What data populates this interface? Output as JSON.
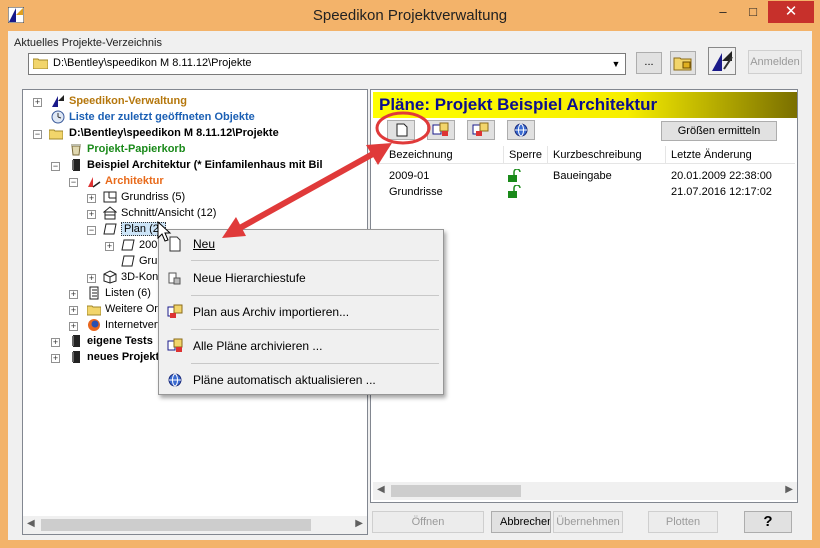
{
  "window": {
    "title": "Speedikon Projektverwaltung",
    "minimize": "–",
    "maximize": "□",
    "close": "✕"
  },
  "directory": {
    "label": "Aktuelles Projekte-Verzeichnis",
    "path": "D:\\Bentley\\speedikon M 8.11.12\\Projekte",
    "browse_label": "...",
    "login_label": "Anmelden"
  },
  "tree": {
    "items": [
      {
        "label": "Speedikon-Verwaltung",
        "color": "#b5770c"
      },
      {
        "label": "Liste der zuletzt geöffneten Objekte",
        "color": "#1a5fb4"
      },
      {
        "label": "D:\\Bentley\\speedikon M 8.11.12\\Projekte",
        "color": "#000000"
      },
      {
        "label": "Projekt-Papierkorb",
        "color": "#1a8a1a"
      },
      {
        "label": "Beispiel Architektur   (* Einfamilenhaus mit Bil",
        "color": "#000000"
      },
      {
        "label": "Architektur",
        "color": "#e86a1a"
      },
      {
        "label": "Grundriss (5)",
        "color": "#000000"
      },
      {
        "label": "Schnitt/Ansicht (12)",
        "color": "#000000"
      },
      {
        "label": "Plan (2)",
        "color": "#000000"
      },
      {
        "label": "200",
        "color": "#000000"
      },
      {
        "label": "Grur",
        "color": "#000000"
      },
      {
        "label": "3D-Kons",
        "color": "#000000"
      },
      {
        "label": "Listen (6)",
        "color": "#000000"
      },
      {
        "label": "Weitere Ord",
        "color": "#000000"
      },
      {
        "label": "Internetverw",
        "color": "#000000"
      },
      {
        "label": "eigene Tests",
        "color": "#000000"
      },
      {
        "label": "neues Projekt",
        "color": "#000000"
      }
    ]
  },
  "plans": {
    "header": "Pläne: Projekt Beispiel Architektur",
    "calc_sizes_label": "Größen ermitteln",
    "columns": [
      "Bezeichnung",
      "Sperre",
      "Kurzbeschreibung",
      "Letzte Änderung"
    ],
    "rows": [
      {
        "name": "2009-01",
        "desc": "Baueingabe",
        "changed": "20.01.2009 22:38:00"
      },
      {
        "name": "Grundrisse",
        "desc": "",
        "changed": "21.07.2016 12:17:02"
      }
    ]
  },
  "context_menu": {
    "items": [
      {
        "label": "Neu"
      },
      {
        "label": "Neue Hierarchiestufe"
      },
      {
        "label": "Plan aus Archiv importieren..."
      },
      {
        "label": "Alle Pläne archivieren ..."
      },
      {
        "label": "Pläne automatisch aktualisieren ..."
      }
    ]
  },
  "buttons": {
    "open": "Öffnen",
    "cancel": "Abbrechen",
    "apply": "Übernehmen",
    "plot": "Plotten",
    "help": "?"
  },
  "colors": {
    "title_bar": "#f3b36a",
    "header_text": "#0b0e8e",
    "header_bg": "#ffff00",
    "annotation_red": "#e03a3a"
  }
}
